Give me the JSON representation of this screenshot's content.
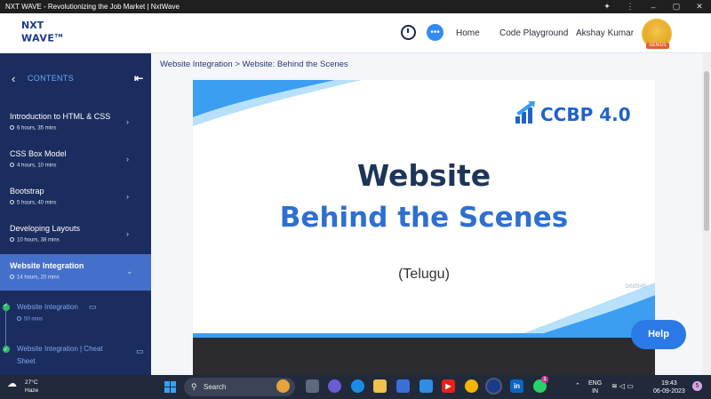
{
  "window": {
    "title": "NXT WAVE - Revolutionizing the Job Market | NxtWave"
  },
  "header": {
    "logo_line1": "NXT",
    "logo_line2": "WAVE",
    "logo_tm": "TM",
    "nav": [
      "Home",
      "Code Playground"
    ],
    "user_name": "Akshay Kumar",
    "avatar_badge": "GENIUS"
  },
  "sidebar": {
    "title": "CONTENTS",
    "modules": [
      {
        "name": "Introduction to HTML & CSS",
        "time": "6 hours, 35 mins"
      },
      {
        "name": "CSS Box Model",
        "time": "4 hours, 10 mins"
      },
      {
        "name": "Bootstrap",
        "time": "5 hours, 40 mins"
      },
      {
        "name": "Developing Layouts",
        "time": "10 hours, 38 mins"
      },
      {
        "name": "Website Integration",
        "time": "14 hours, 20 mins"
      }
    ],
    "lessons": [
      {
        "name": "Website Integration",
        "time": "50 mins"
      },
      {
        "name_line1": "Website Integration | Cheat",
        "name_line2": "Sheet"
      }
    ]
  },
  "main": {
    "breadcrumb": "Website Integration > Website: Behind the Scenes",
    "slide": {
      "brand": "CCBP 4.0",
      "title_line1": "Website",
      "title_line2": "Behind the Scenes",
      "subtitle": "(Telugu)",
      "code": "b6d94b"
    },
    "help_label": "Help"
  },
  "taskbar": {
    "temperature": "27°C",
    "condition": "Haze",
    "search_label": "Search",
    "lang_line1": "ENG",
    "lang_line2": "IN",
    "time": "19:43",
    "date": "06-09-2023",
    "whatsapp_badge": "1",
    "notification_count": "5"
  },
  "colors": {
    "sidebar_bg": "#1b2d5e",
    "sidebar_active": "#4470cc",
    "accent": "#2f6fcf",
    "completed": "#2fb86a"
  }
}
